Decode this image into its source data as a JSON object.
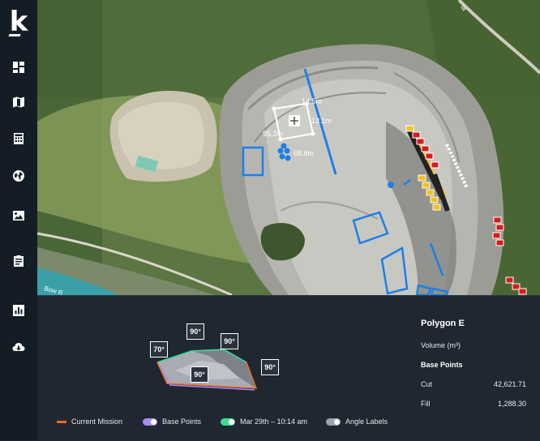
{
  "app": {
    "logo_letter": "k"
  },
  "sidebar": {
    "items": [
      {
        "icon": "dashboard-icon"
      },
      {
        "icon": "map-icon"
      },
      {
        "icon": "calculator-icon"
      },
      {
        "icon": "globe-icon"
      },
      {
        "icon": "image-icon"
      },
      {
        "icon": "report-icon"
      },
      {
        "icon": "chart-icon"
      },
      {
        "icon": "cloud-download-icon"
      }
    ]
  },
  "map": {
    "measure_labels": {
      "top": "14.5m",
      "right": "13.1m",
      "left": "95.2m",
      "bottom": "68.6m"
    },
    "road_label": "Bow R",
    "edge_label": "ta",
    "colors": {
      "polygon_blue": "#1e7fe8",
      "marker_red": "#d81b1b",
      "marker_yellow": "#f3c21a"
    }
  },
  "panel": {
    "angles": {
      "a1": "70°",
      "a2": "90°",
      "a3": "90°",
      "a4": "90°",
      "a5": "90°"
    },
    "info": {
      "title": "Polygon E",
      "volume_label": "Volume (m³)",
      "section": "Base Points",
      "cut_label": "Cut",
      "cut_value": "42,621.71",
      "fill_label": "Fill",
      "fill_value": "1,288.30"
    },
    "legend": {
      "current_mission": "Current Mission",
      "base_points": "Base Points",
      "date": "Mar 29th – 10:14 am",
      "angle_labels": "Angle Labels",
      "colors": {
        "current_mission": "#f06a1d",
        "base_points": "#a78bfa",
        "date": "#3ddc97",
        "angle_labels": "#9aa3ad"
      }
    }
  }
}
